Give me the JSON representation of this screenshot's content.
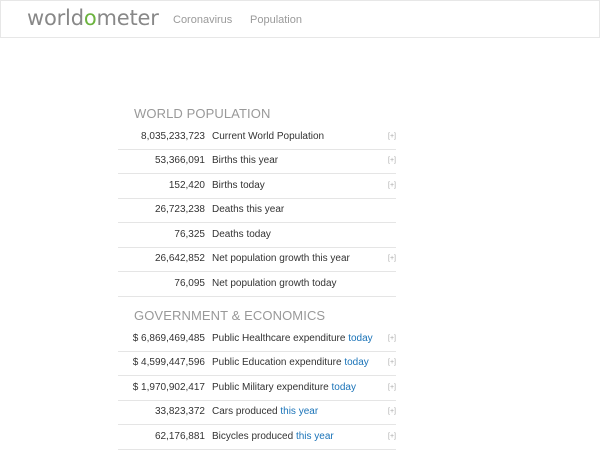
{
  "header": {
    "logo_pre": "world",
    "logo_mark": "o",
    "logo_post": "meter",
    "nav": [
      "Coronavirus",
      "Population"
    ]
  },
  "sections": [
    {
      "title": "WORLD POPULATION",
      "rows": [
        {
          "value": "8,035,233,723",
          "label": "Current World Population",
          "highlight": "",
          "plus": "[+]"
        },
        {
          "value": "53,366,091",
          "label": "Births this year",
          "highlight": "",
          "plus": "[+]"
        },
        {
          "value": "152,420",
          "label": "Births today",
          "highlight": "",
          "plus": "[+]"
        },
        {
          "value": "26,723,238",
          "label": "Deaths this year",
          "highlight": "",
          "plus": ""
        },
        {
          "value": "76,325",
          "label": "Deaths today",
          "highlight": "",
          "plus": ""
        },
        {
          "value": "26,642,852",
          "label": "Net population growth this year",
          "highlight": "",
          "plus": "[+]"
        },
        {
          "value": "76,095",
          "label": "Net population growth today",
          "highlight": "",
          "plus": ""
        }
      ]
    },
    {
      "title": "GOVERNMENT & ECONOMICS",
      "rows": [
        {
          "value": "$ 6,869,469,485",
          "label": "Public Healthcare expenditure ",
          "highlight": "today",
          "plus": "[+]"
        },
        {
          "value": "$ 4,599,447,596",
          "label": "Public Education expenditure ",
          "highlight": "today",
          "plus": "[+]"
        },
        {
          "value": "$ 1,970,902,417",
          "label": "Public Military expenditure ",
          "highlight": "today",
          "plus": "[+]"
        },
        {
          "value": "33,823,372",
          "label": "Cars produced ",
          "highlight": "this year",
          "plus": "[+]"
        },
        {
          "value": "62,176,881",
          "label": "Bicycles produced ",
          "highlight": "this year",
          "plus": "[+]"
        }
      ]
    }
  ]
}
